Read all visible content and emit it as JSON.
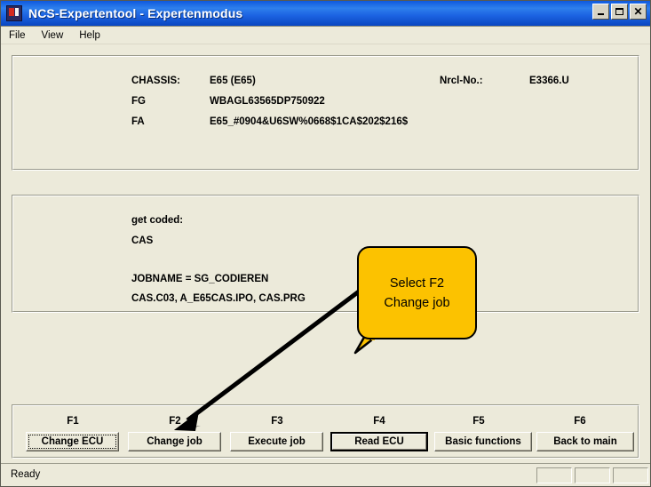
{
  "window": {
    "title": "NCS-Expertentool - Expertenmodus",
    "icon": "app-icon",
    "controls": {
      "minimize": "–",
      "maximize": "□",
      "close": "✕"
    }
  },
  "menu": {
    "items": [
      {
        "label": "File"
      },
      {
        "label": "View"
      },
      {
        "label": "Help"
      }
    ]
  },
  "info_panel": {
    "rows": [
      {
        "label": "CHASSIS:",
        "value": "E65 (E65)"
      },
      {
        "label": "FG",
        "value": "WBAGL63565DP750922"
      },
      {
        "label": "FA",
        "value": "E65_#0904&U6SW%0668$1CA$202$216$"
      }
    ],
    "right": {
      "label": "Nrcl-No.:",
      "value": "E3366.U"
    }
  },
  "job_panel": {
    "get_coded_label": "get coded:",
    "ecu": "CAS",
    "jobname": "JOBNAME = SG_CODIEREN",
    "files": "CAS.C03, A_E65CAS.IPO, CAS.PRG"
  },
  "callout": {
    "line1": "Select F2",
    "line2": "Change job",
    "fill_color": "#FCC200",
    "border_color": "#000000"
  },
  "function_bar": {
    "buttons": [
      {
        "key": "F1",
        "label": "Change ECU",
        "state": "focused"
      },
      {
        "key": "F2",
        "label": "Change job",
        "state": "normal"
      },
      {
        "key": "F3",
        "label": "Execute job",
        "state": "normal"
      },
      {
        "key": "F4",
        "label": "Read ECU",
        "state": "default"
      },
      {
        "key": "F5",
        "label": "Basic functions",
        "state": "normal"
      },
      {
        "key": "F6",
        "label": "Back to main",
        "state": "normal"
      }
    ]
  },
  "statusbar": {
    "message": "Ready",
    "panes": [
      "",
      "",
      ""
    ]
  },
  "colors": {
    "window_face": "#ECEADA",
    "titlebar_blue": "#1C63E2",
    "accent_yellow": "#FCC200"
  }
}
